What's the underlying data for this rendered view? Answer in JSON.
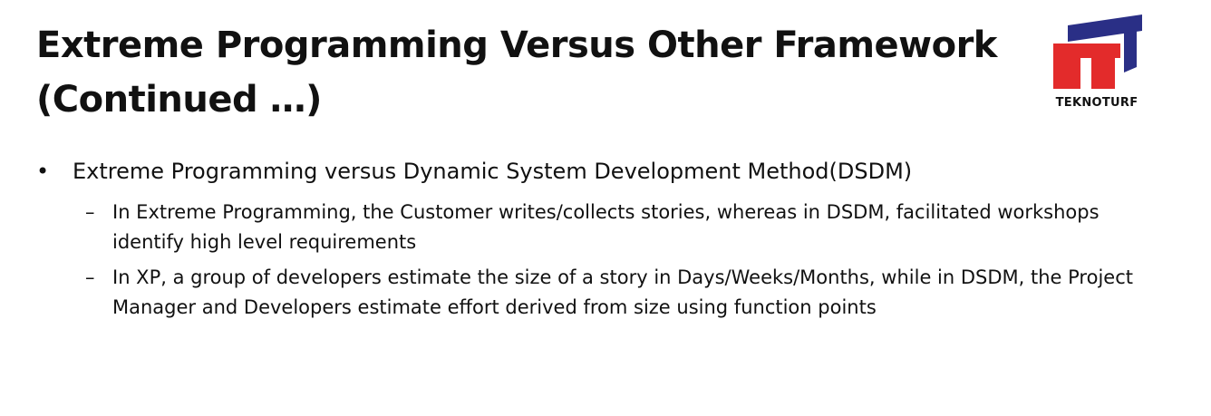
{
  "slide": {
    "title_line1": "Extreme Programming Versus Other Framework",
    "title_line2": "(Continued …)"
  },
  "logo": {
    "text": "TEKNOTURF",
    "colors": {
      "red": "#e32b2b",
      "navy": "#2a2f86"
    }
  },
  "content": {
    "bullet_marker": "•",
    "sub_marker": "–",
    "bullet": "Extreme Programming versus Dynamic System Development Method(DSDM)",
    "sub_items": [
      "In Extreme Programming, the Customer writes/collects stories, whereas in DSDM, facilitated workshops identify high level requirements",
      "In XP, a group of developers estimate the size of a story in Days/Weeks/Months, while in DSDM, the Project Manager and Developers estimate effort derived from size using function points"
    ]
  }
}
